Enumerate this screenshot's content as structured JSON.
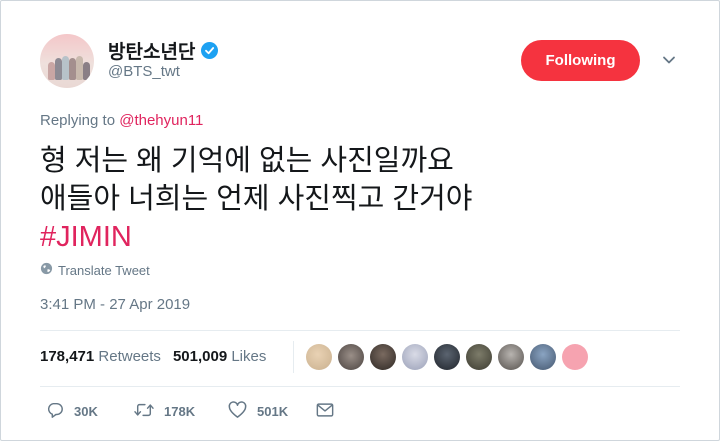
{
  "author": {
    "display_name": "방탄소년단",
    "handle": "@BTS_twt",
    "verified": true
  },
  "header": {
    "follow_label": "Following",
    "follow_color": "#f5333f"
  },
  "reply": {
    "prefix": "Replying to",
    "mention": "@thehyun11"
  },
  "tweet": {
    "lines": [
      "형 저는 왜 기억에 없는 사진일까요",
      "애들아 너희는 언제 사진찍고 간거야"
    ],
    "hashtag": "#JIMIN",
    "hashtag_color": "#e0245e"
  },
  "translate_label": "Translate Tweet",
  "timestamp": "3:41 PM - 27 Apr 2019",
  "stats": {
    "retweets_count": "178,471",
    "retweets_label": "Retweets",
    "likes_count": "501,009",
    "likes_label": "Likes"
  },
  "actions": {
    "replies": "30K",
    "retweets": "178K",
    "likes": "501K"
  },
  "colors": {
    "accent": "#1da1f2",
    "muted": "#657786",
    "text": "#14171a"
  }
}
